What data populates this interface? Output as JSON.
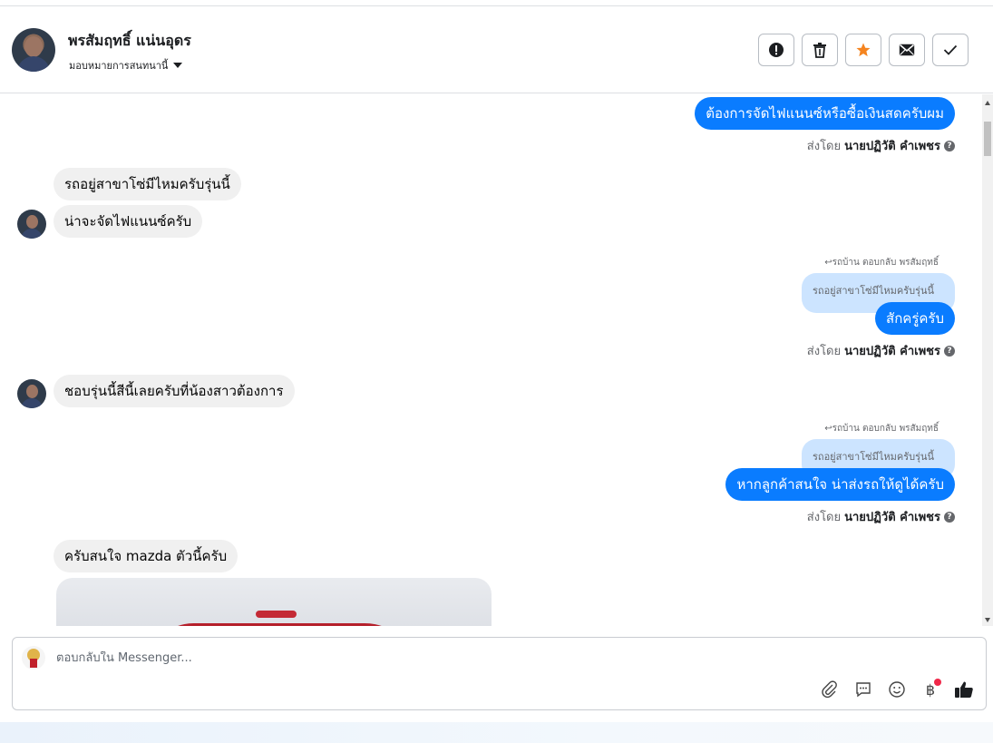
{
  "header": {
    "contact_name": "พรสัมฤทธิ์ แน่นอุดร",
    "assign_label": "มอบหมายการสนทนานี้",
    "actions": [
      "spam-icon",
      "trash-icon",
      "star-icon",
      "mail-icon",
      "check-icon"
    ]
  },
  "messages": {
    "m1_text": "ต้องการจัดไฟแนนซ์หรือซื้อเงินสดครับผม",
    "sent_by_prefix": "ส่งโดย",
    "sent_by_name": "นายปฏิวัติ คำเพชร",
    "m2_text": "รถอยู่สาขาโซ่มีไหมครับรุ่นนี้",
    "m3_text": "น่าจะจัดไฟแนนซ์ครับ",
    "reply_tag": "รถบ้าน ตอบกลับ พรสัมฤทธิ์",
    "quoted_text": "รถอยู่สาขาโซ่มีไหมครับรุ่นนี้",
    "m4_text": "สักครู่ครับ",
    "m5_text": "ชอบรุ่นนี้สีนี้เลยครับที่น้องสาวต้องการ",
    "m6_text": "หากลูกค้าสนใจ น่าส่งรถให้ดูได้ครับ",
    "m7_text": "ครับสนใจ mazda ตัวนี้ครับ"
  },
  "composer": {
    "placeholder": "ตอบกลับใน Messenger...",
    "tools": [
      "paperclip-icon",
      "comment-icon",
      "emoji-icon",
      "baht-icon",
      "thumbs-up-icon"
    ]
  },
  "colors": {
    "outgoing": "#0a7cff",
    "incoming": "#f0f0f0",
    "quoted": "#cce4ff",
    "star": "#f5841f"
  }
}
